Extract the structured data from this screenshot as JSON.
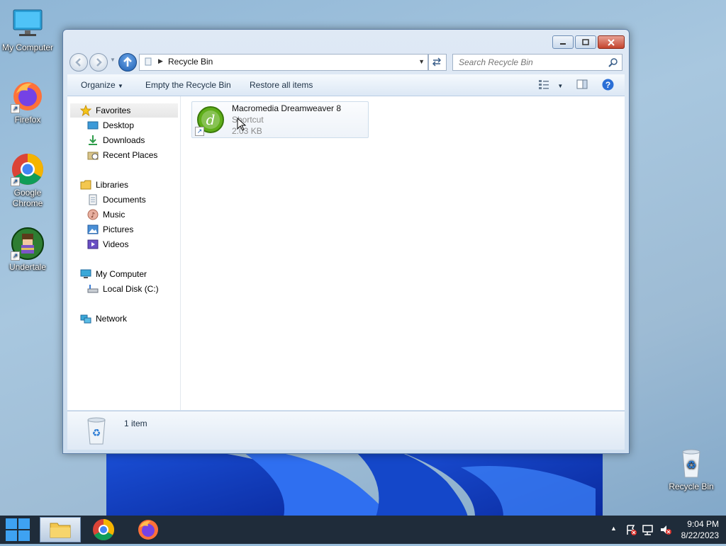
{
  "desktop": {
    "icons": [
      {
        "label": "My Computer"
      },
      {
        "label": "Firefox"
      },
      {
        "label": "Google Chrome"
      },
      {
        "label": "Undertale"
      },
      {
        "label": "Recycle Bin"
      }
    ]
  },
  "window": {
    "address": {
      "location": "Recycle Bin"
    },
    "search": {
      "placeholder": "Search Recycle Bin"
    },
    "toolbar": {
      "organize_label": "Organize",
      "empty_label": "Empty the Recycle Bin",
      "restore_label": "Restore all items"
    },
    "nav": {
      "favorites": "Favorites",
      "desktop": "Desktop",
      "downloads": "Downloads",
      "recent": "Recent Places",
      "libraries": "Libraries",
      "documents": "Documents",
      "music": "Music",
      "pictures": "Pictures",
      "videos": "Videos",
      "computer": "My Computer",
      "localdisk": "Local Disk (C:)",
      "network": "Network"
    },
    "files": [
      {
        "name": "Macromedia Dreamweaver 8",
        "type": "Shortcut",
        "size": "2.03 KB"
      }
    ],
    "status": {
      "count": "1 item"
    }
  },
  "taskbar": {
    "time": "9:04 PM",
    "date": "8/22/2023"
  },
  "colors": {
    "accent": "#1d5fb3",
    "window_frame": "#cfdff0",
    "taskbar": "#1f2c3a"
  }
}
